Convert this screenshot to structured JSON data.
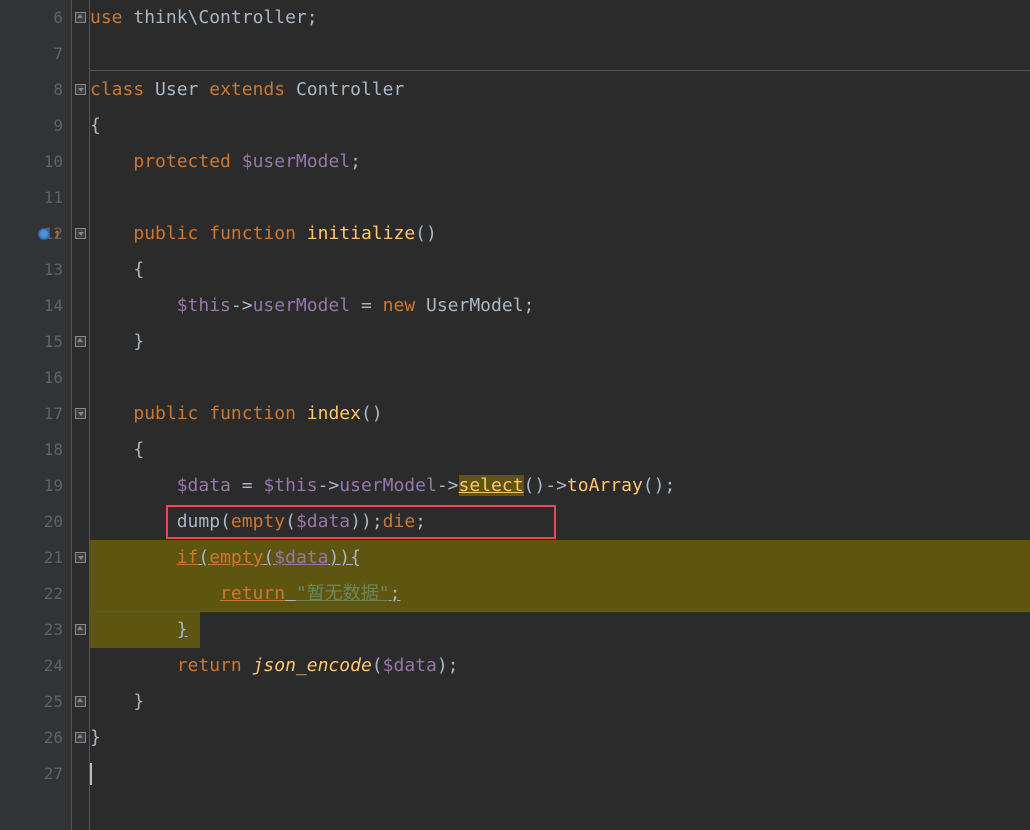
{
  "lines": {
    "6": {
      "num": "6"
    },
    "7": {
      "num": "7"
    },
    "8": {
      "num": "8"
    },
    "9": {
      "num": "9"
    },
    "10": {
      "num": "10"
    },
    "11": {
      "num": "11"
    },
    "12": {
      "num": "12"
    },
    "13": {
      "num": "13"
    },
    "14": {
      "num": "14"
    },
    "15": {
      "num": "15"
    },
    "16": {
      "num": "16"
    },
    "17": {
      "num": "17"
    },
    "18": {
      "num": "18"
    },
    "19": {
      "num": "19"
    },
    "20": {
      "num": "20"
    },
    "21": {
      "num": "21"
    },
    "22": {
      "num": "22"
    },
    "23": {
      "num": "23"
    },
    "24": {
      "num": "24"
    },
    "25": {
      "num": "25"
    },
    "26": {
      "num": "26"
    },
    "27": {
      "num": "27"
    }
  },
  "tokens": {
    "use": "use",
    "think_controller": "think\\Controller",
    "class": "class",
    "User": "User",
    "extends": "extends",
    "Controller": "Controller",
    "lbrace": "{",
    "rbrace": "}",
    "protected": "protected",
    "userModel_var": "$userModel",
    "public": "public",
    "function": "function",
    "initialize": "initialize",
    "parens": "()",
    "this": "$this",
    "arrow": "->",
    "userModel_prop": "userModel",
    "eq": " = ",
    "new": "new",
    "UserModel": "UserModel",
    "index": "index",
    "data": "$data",
    "select": "select",
    "toArray": "toArray",
    "dump": "dump",
    "empty": "empty",
    "lparen": "(",
    "rparen": ")",
    "dlparen": "((",
    "drparen": "))",
    "die": "die",
    "if": "if",
    "return": "return",
    "str_nodata": "\"暂无数据\"",
    "json_encode": "json_encode",
    "semi": ";"
  }
}
